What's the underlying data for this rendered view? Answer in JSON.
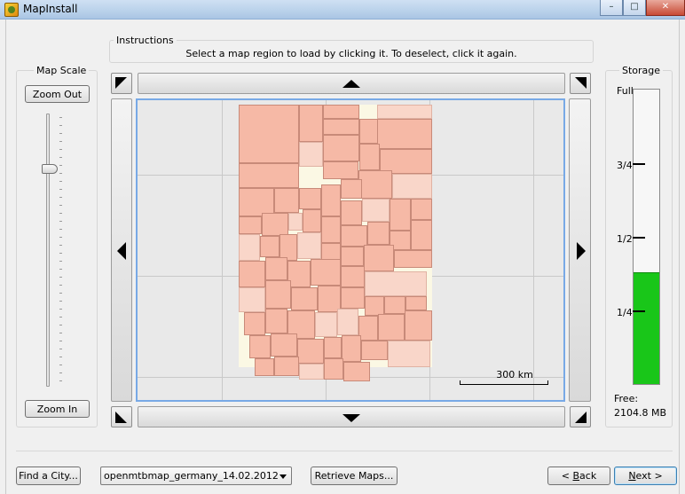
{
  "window": {
    "title": "MapInstall",
    "min": "–",
    "max": "□",
    "close": "✕"
  },
  "instructions": {
    "label": "Instructions",
    "text": "Select a map region to load by clicking it. To deselect, click it again."
  },
  "map_scale": {
    "label": "Map Scale",
    "zoom_out": "Zoom Out",
    "zoom_in": "Zoom In"
  },
  "map": {
    "scale_text": "300 km"
  },
  "storage": {
    "label": "Storage",
    "ticks": {
      "full": "Full",
      "three_quarter": "3/4",
      "half": "1/2",
      "quarter": "1/4"
    },
    "fill_fraction": 0.38,
    "free_label": "Free:",
    "free_value": "2104.8 MB",
    "fill_color": "#19c619"
  },
  "bottom": {
    "find_city": "Find a City...",
    "map_select": "openmtbmap_germany_14.02.2012",
    "retrieve": "Retrieve Maps...",
    "back_prefix": "< ",
    "back_key": "B",
    "back_rest": "ack",
    "next_key": "N",
    "next_rest": "ext >"
  }
}
